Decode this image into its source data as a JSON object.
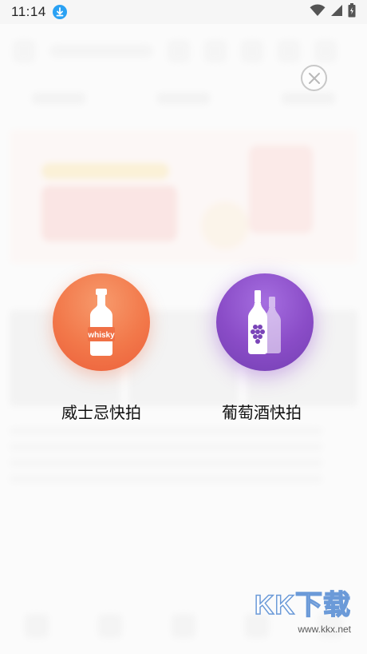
{
  "status_bar": {
    "time": "11:14",
    "icons": [
      "download-icon",
      "wifi-icon",
      "signal-icon",
      "battery-icon"
    ]
  },
  "overlay": {
    "close_icon": "close-icon",
    "actions": [
      {
        "label": "威士忌快拍",
        "icon": "whisky-bottle-icon",
        "bottle_text": "whisky",
        "color": "#f2784a"
      },
      {
        "label": "葡萄酒快拍",
        "icon": "wine-bottles-icon",
        "color": "#8a4cc7"
      }
    ]
  },
  "watermark": {
    "logo": "KK下载",
    "url": "www.kkx.net"
  }
}
